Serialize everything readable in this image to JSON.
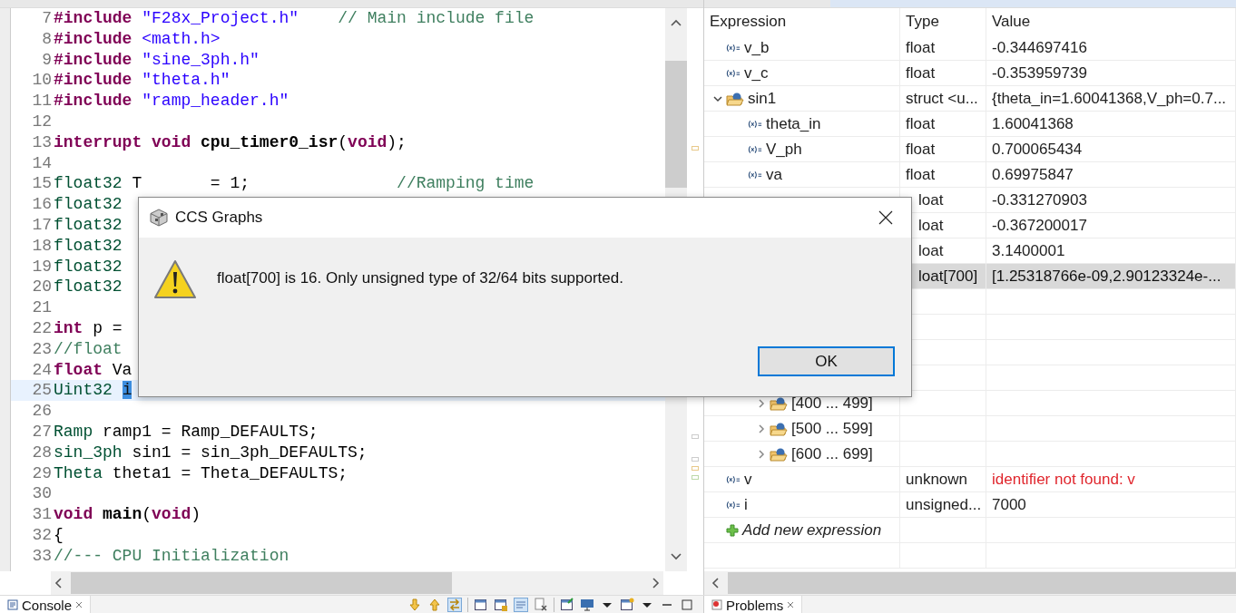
{
  "editor": {
    "lines": [
      {
        "number": "7",
        "tokens": [
          {
            "text": "#include",
            "kind": "kw"
          },
          {
            "text": " \"F28x_Project.h\"",
            "kind": "str"
          },
          {
            "text": "    // Main include file",
            "kind": "cm"
          }
        ]
      },
      {
        "number": "8",
        "tokens": [
          {
            "text": "#include",
            "kind": "kw"
          },
          {
            "text": " <math.h>",
            "kind": "str"
          }
        ]
      },
      {
        "number": "9",
        "tokens": [
          {
            "text": "#include",
            "kind": "kw"
          },
          {
            "text": " \"sine_3ph.h\"",
            "kind": "str"
          }
        ]
      },
      {
        "number": "10",
        "tokens": [
          {
            "text": "#include",
            "kind": "kw"
          },
          {
            "text": " \"theta.h\"",
            "kind": "str"
          }
        ]
      },
      {
        "number": "11",
        "tokens": [
          {
            "text": "#include",
            "kind": "kw"
          },
          {
            "text": " \"ramp_header.h\"",
            "kind": "str"
          }
        ]
      },
      {
        "number": "12"
      },
      {
        "number": "13",
        "tokens": [
          {
            "text": "interrupt",
            "kind": "kw"
          },
          {
            "text": " void",
            "kind": "kw"
          },
          {
            "text": " cpu_timer0_isr",
            "kind": "fn"
          },
          {
            "text": "(",
            "kind": "plain"
          },
          {
            "text": "void",
            "kind": "kw"
          },
          {
            "text": ");",
            "kind": "plain"
          }
        ]
      },
      {
        "number": "14"
      },
      {
        "number": "15",
        "tokens": [
          {
            "text": "float32",
            "kind": "ty"
          },
          {
            "text": " T       = 1;               ",
            "kind": "plain"
          },
          {
            "text": "//Ramping time",
            "kind": "cm"
          }
        ]
      },
      {
        "number": "16",
        "tokens": [
          {
            "text": "float32",
            "kind": "ty"
          }
        ]
      },
      {
        "number": "17",
        "tokens": [
          {
            "text": "float32",
            "kind": "ty"
          }
        ]
      },
      {
        "number": "18",
        "tokens": [
          {
            "text": "float32",
            "kind": "ty"
          }
        ]
      },
      {
        "number": "19",
        "tokens": [
          {
            "text": "float32",
            "kind": "ty"
          }
        ]
      },
      {
        "number": "20",
        "tokens": [
          {
            "text": "float32",
            "kind": "ty"
          }
        ]
      },
      {
        "number": "21"
      },
      {
        "number": "22",
        "tokens": [
          {
            "text": "int",
            "kind": "kw"
          },
          {
            "text": " p =",
            "kind": "plain"
          }
        ]
      },
      {
        "number": "23",
        "tokens": [
          {
            "text": "//float",
            "kind": "cm"
          }
        ]
      },
      {
        "number": "24",
        "tokens": [
          {
            "text": "float",
            "kind": "kw"
          },
          {
            "text": " Va",
            "kind": "plain"
          }
        ]
      },
      {
        "number": "25",
        "current": true,
        "tokens": [
          {
            "text": "Uint32 ",
            "kind": "ty"
          },
          {
            "text": "i",
            "kind": "sel"
          }
        ]
      },
      {
        "number": "26"
      },
      {
        "number": "27",
        "tokens": [
          {
            "text": "Ramp",
            "kind": "ty"
          },
          {
            "text": " ramp1 = Ramp_DEFAULTS;",
            "kind": "plain"
          }
        ]
      },
      {
        "number": "28",
        "tokens": [
          {
            "text": "sin_3ph",
            "kind": "ty"
          },
          {
            "text": " sin1 = sin_3ph_DEFAULTS;",
            "kind": "plain"
          }
        ]
      },
      {
        "number": "29",
        "tokens": [
          {
            "text": "Theta",
            "kind": "ty"
          },
          {
            "text": " theta1 = Theta_DEFAULTS;",
            "kind": "plain"
          }
        ]
      },
      {
        "number": "30"
      },
      {
        "number": "31",
        "tokens": [
          {
            "text": "void",
            "kind": "kw"
          },
          {
            "text": " main",
            "kind": "fn"
          },
          {
            "text": "(",
            "kind": "plain"
          },
          {
            "text": "void",
            "kind": "kw"
          },
          {
            "text": ")",
            "kind": "plain"
          }
        ]
      },
      {
        "number": "32",
        "tokens": [
          {
            "text": "{",
            "kind": "plain"
          }
        ]
      },
      {
        "number": "33",
        "tokens": [
          {
            "text": "//--- CPU Initialization",
            "kind": "cm"
          }
        ]
      }
    ]
  },
  "expressions": {
    "columns": [
      "Expression",
      "Type",
      "Value"
    ],
    "rows": [
      {
        "kind": "variable",
        "name": "v_b",
        "type": "float",
        "value": "-0.344697416",
        "selected": false
      },
      {
        "kind": "variable",
        "name": "v_c",
        "type": "float",
        "value": "-0.353959739",
        "selected": false
      },
      {
        "kind": "struct",
        "name": "sin1",
        "type": "struct <u...",
        "value": "{theta_in=1.60041368,V_ph=0.7...",
        "selected": false,
        "expanded": true,
        "children": [
          {
            "kind": "variable",
            "name": "theta_in",
            "type": "float",
            "value": "1.60041368",
            "selected": false
          },
          {
            "kind": "variable",
            "name": "V_ph",
            "type": "float",
            "value": "0.700065434",
            "selected": false
          },
          {
            "kind": "variable",
            "name": "va",
            "type": "float",
            "value": "0.69975847",
            "selected": false
          },
          {
            "type": "loat",
            "value": "-0.331270903",
            "selected": false
          },
          {
            "type": "loat",
            "value": "-0.367200017",
            "selected": false
          },
          {
            "type": "loat",
            "value": "3.1400001",
            "selected": false
          },
          {
            "type": "loat[700]",
            "value": "[1.25318766e-09,2.90123324e-...",
            "selected": true,
            "expanded": true,
            "children": [
              {
                "kind": "range",
                "name": "[400 ... 499]",
                "selected": false,
                "expanded": false
              },
              {
                "kind": "range",
                "name": "[500 ... 599]",
                "selected": false,
                "expanded": false
              },
              {
                "kind": "range",
                "name": "[600 ... 699]",
                "selected": false,
                "expanded": false
              }
            ]
          }
        ]
      },
      {
        "kind": "variable",
        "name": "v",
        "type": "unknown",
        "value": "identifier not found: v",
        "error": true,
        "selected": false
      },
      {
        "kind": "variable",
        "name": "i",
        "type": "unsigned...",
        "value": "7000",
        "selected": false
      },
      {
        "kind": "add",
        "name": "Add new expression",
        "selected": false
      }
    ]
  },
  "dialog": {
    "title": "CCS Graphs",
    "message": "float[700] is 16. Only unsigned type of 32/64 bits supported.",
    "buttons": [
      "OK"
    ]
  },
  "bottom_tabs": [
    "Console",
    "Problems"
  ]
}
